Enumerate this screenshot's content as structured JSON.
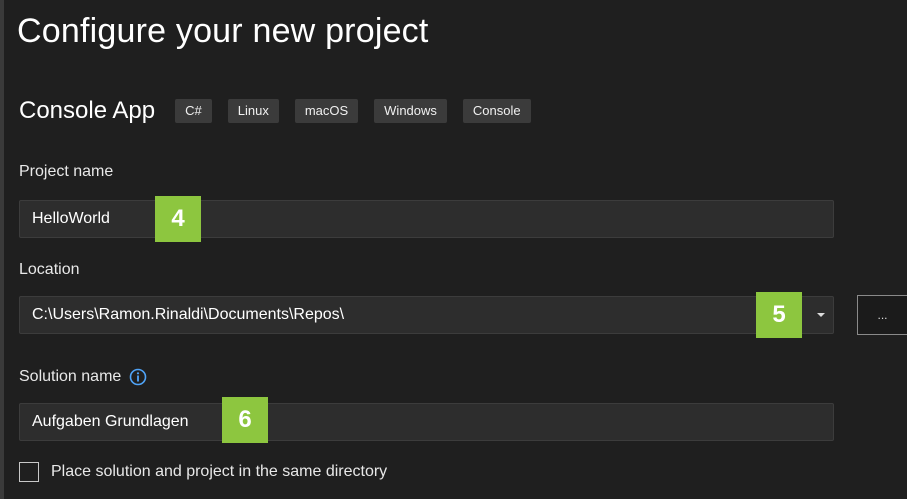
{
  "page": {
    "title": "Configure your new project"
  },
  "template": {
    "name": "Console App",
    "tags": [
      "C#",
      "Linux",
      "macOS",
      "Windows",
      "Console"
    ]
  },
  "project_name": {
    "label": "Project name",
    "value": "HelloWorld",
    "badge": "4"
  },
  "location": {
    "label": "Location",
    "value": "C:\\Users\\Ramon.Rinaldi\\Documents\\Repos\\",
    "badge": "5",
    "dropdown_icon": "chevron-down-icon",
    "browse_label": "..."
  },
  "solution_name": {
    "label": "Solution name",
    "value": "Aufgaben Grundlagen",
    "badge": "6",
    "info_icon": "info-icon"
  },
  "checkbox": {
    "label": "Place solution and project in the same directory",
    "checked": false
  },
  "colors": {
    "background": "#1f1f1f",
    "input_background": "#2d2d2d",
    "tag_background": "#3b3b3b",
    "badge_green": "#8dc63f",
    "info_blue": "#4fa3f7"
  }
}
